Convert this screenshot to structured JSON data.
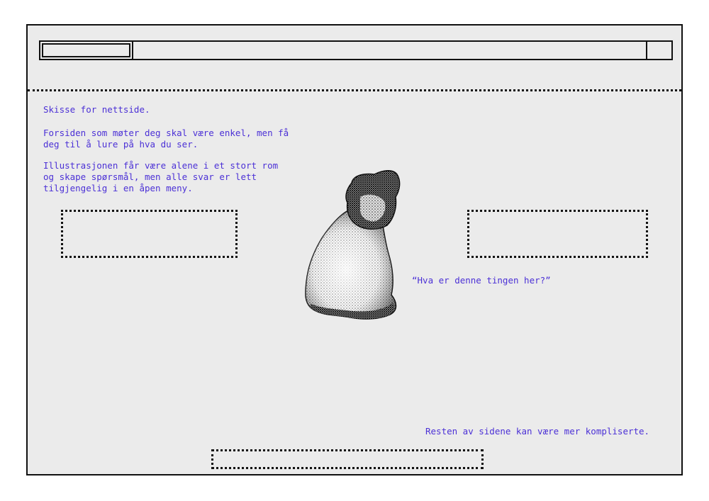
{
  "sketch": {
    "title_note": "Skisse for nettside.",
    "intro_note": "Forsiden som møter deg skal være enkel, men få\ndeg til å lure på hva du ser.",
    "illustration_note": "Illustrasjonen får være alene i et stort rom\nog skape spørsmål, men alle svar er lett\ntilgjengelig i en åpen meny.",
    "question_note": "“Hva er denne tingen her?”",
    "rest_note": "Resten av sidene kan være mer kompliserte."
  },
  "illustration": {
    "icon": "stippled-cat-figurine-icon"
  },
  "colors": {
    "annotation": "#4b30d6",
    "background": "#ebebeb",
    "ink": "#111111"
  }
}
